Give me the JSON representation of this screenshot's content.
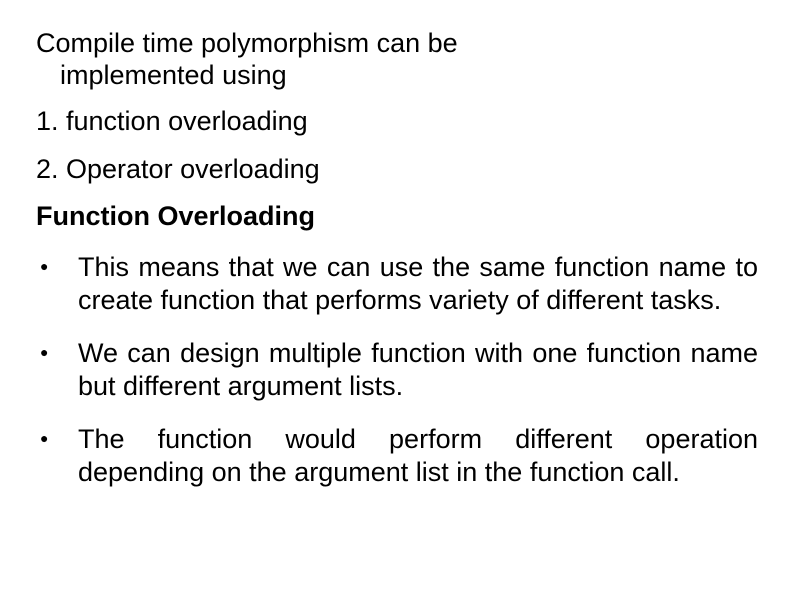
{
  "title_line1": "Compile time polymorphism can be",
  "title_line2": "implemented using",
  "numbered_items": [
    "1. function overloading",
    "2. Operator overloading"
  ],
  "section_heading": "Function Overloading",
  "bullets": [
    "This means that we can use the same function name to create function that performs variety of different tasks.",
    "We can design multiple function with one function name but different argument lists.",
    "The function would perform different operation depending on the argument list in the function call."
  ]
}
